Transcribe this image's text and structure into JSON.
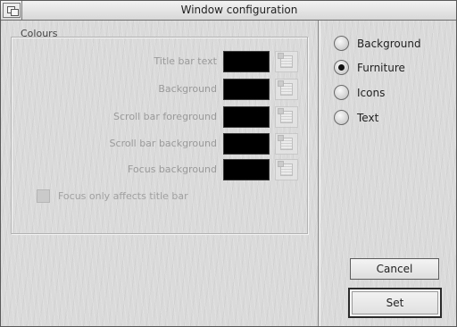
{
  "window": {
    "title": "Window configuration",
    "back_icon": "window-back-icon"
  },
  "colours": {
    "heading": "Colours",
    "rows": [
      {
        "label": "Title bar text",
        "colour": "#000000"
      },
      {
        "label": "Background",
        "colour": "#000000"
      },
      {
        "label": "Scroll bar foreground",
        "colour": "#000000"
      },
      {
        "label": "Scroll bar background",
        "colour": "#000000"
      },
      {
        "label": "Focus background",
        "colour": "#000000"
      }
    ],
    "picker_icon": "palette-icon",
    "focus_only": {
      "label": "Focus only affects title bar",
      "checked": false
    }
  },
  "options": {
    "items": [
      {
        "label": "Background",
        "selected": false
      },
      {
        "label": "Furniture",
        "selected": true
      },
      {
        "label": "Icons",
        "selected": false
      },
      {
        "label": "Text",
        "selected": false
      }
    ]
  },
  "buttons": {
    "cancel": "Cancel",
    "set": "Set"
  }
}
